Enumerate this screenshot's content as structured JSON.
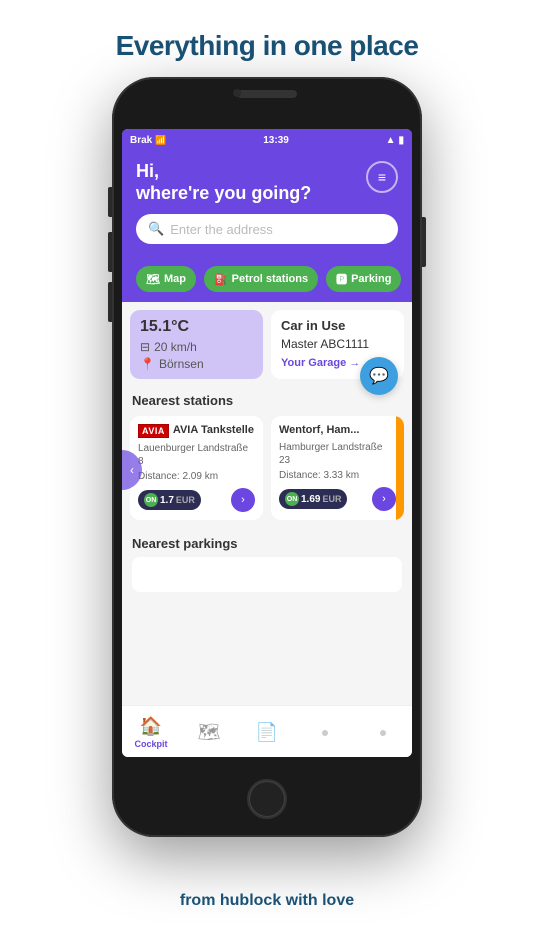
{
  "page": {
    "title": "Everything in one place",
    "tagline": "from hublock with love"
  },
  "status_bar": {
    "carrier": "Brak",
    "time": "13:39",
    "signal": "▲",
    "wifi": "wifi",
    "battery": "🔋"
  },
  "header": {
    "greeting_line1": "Hi,",
    "greeting_line2": "where're you going?",
    "search_placeholder": "Enter the address",
    "menu_icon": "≡"
  },
  "filter_buttons": [
    {
      "label": "Map",
      "icon": "🗺"
    },
    {
      "label": "Petrol stations",
      "icon": "⛽"
    },
    {
      "label": "Parking",
      "icon": "🅿"
    }
  ],
  "weather_card": {
    "temperature": "15.1°C",
    "speed": "20 km/h",
    "location": "Börnsen"
  },
  "car_card": {
    "title": "Car in Use",
    "plate": "Master ABC1111",
    "garage_link": "Your Garage →"
  },
  "chat_fab": {
    "icon": "💬"
  },
  "nearest_stations": {
    "section_title": "Nearest stations",
    "stations": [
      {
        "name": "AVIA Tankstelle",
        "brand": "AVIA",
        "address": "Lauenburger Landstraße 8",
        "distance": "Distance: 2.09 km",
        "status": "ON",
        "price": "1.7",
        "currency": "EUR"
      },
      {
        "name": "Wentorf, Ham...",
        "brand": "ORANGE",
        "address": "Hamburger Landstraße 23",
        "distance": "Distance: 3.33 km",
        "status": "ON",
        "price": "1.69",
        "currency": "EUR"
      }
    ]
  },
  "nearest_parkings": {
    "section_title": "Nearest parkings"
  },
  "bottom_nav": [
    {
      "label": "Cockpit",
      "icon": "🏠",
      "active": true
    },
    {
      "label": "map",
      "icon": "🗺",
      "active": false
    },
    {
      "label": "doc",
      "icon": "📄",
      "active": false
    },
    {
      "label": "dot1",
      "icon": "•",
      "active": false
    },
    {
      "label": "dot2",
      "icon": "•",
      "active": false
    }
  ]
}
